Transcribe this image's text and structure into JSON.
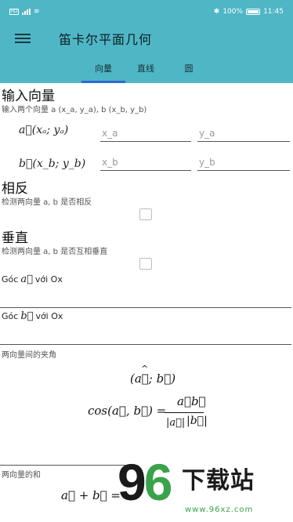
{
  "status": {
    "battery": "100%",
    "time": "11:45",
    "bt": "✱",
    "sim": "HD"
  },
  "app": {
    "title": "笛卡尔平面几何"
  },
  "tabs": [
    {
      "label": "向量",
      "active": true
    },
    {
      "label": "直线",
      "active": false
    },
    {
      "label": "圆",
      "active": false
    }
  ],
  "input_section": {
    "title": "输入向量",
    "subtitle": "输入两个向量 a (x_a, y_a), b (x_b, y_b)",
    "vec_a_label": "a⃗(xₐ; yₐ)",
    "vec_b_label": "b⃗(x_b; y_b)",
    "xa_placeholder": "x_a",
    "ya_placeholder": "y_a",
    "xb_placeholder": "x_b",
    "yb_placeholder": "y_b"
  },
  "opposite": {
    "title": "相反",
    "subtitle": "检测两向量 a, b 是否相反"
  },
  "perpendicular": {
    "title": "垂直",
    "subtitle": "检测两向量 a, b 是否互相垂直"
  },
  "angles": {
    "a_prefix": "Góc",
    "a_vec": "a⃗",
    "a_suffix": "với Ox",
    "b_prefix": "Góc",
    "b_vec": "b⃗",
    "b_suffix": "với Ox"
  },
  "angle_between": {
    "label": "两向量间的夹角",
    "formula_top": "(a⃗; b⃗)",
    "formula_hat": "^",
    "cos_lhs": "cos(a⃗, b⃗) =",
    "numerator": "a⃗b⃗",
    "den_a": "|a⃗|",
    "den_b": "|b⃗|"
  },
  "sum": {
    "label": "两向量的和",
    "formula": "a⃗ + b⃗ ="
  },
  "watermark": {
    "num_9": "9",
    "num_6": "6",
    "text": "下载站",
    "url": "www.96xz.com"
  },
  "colors": {
    "header": "#4fb6c6",
    "tab_indicator": "#2b6ad6",
    "watermark_green": "#3aa24a"
  }
}
